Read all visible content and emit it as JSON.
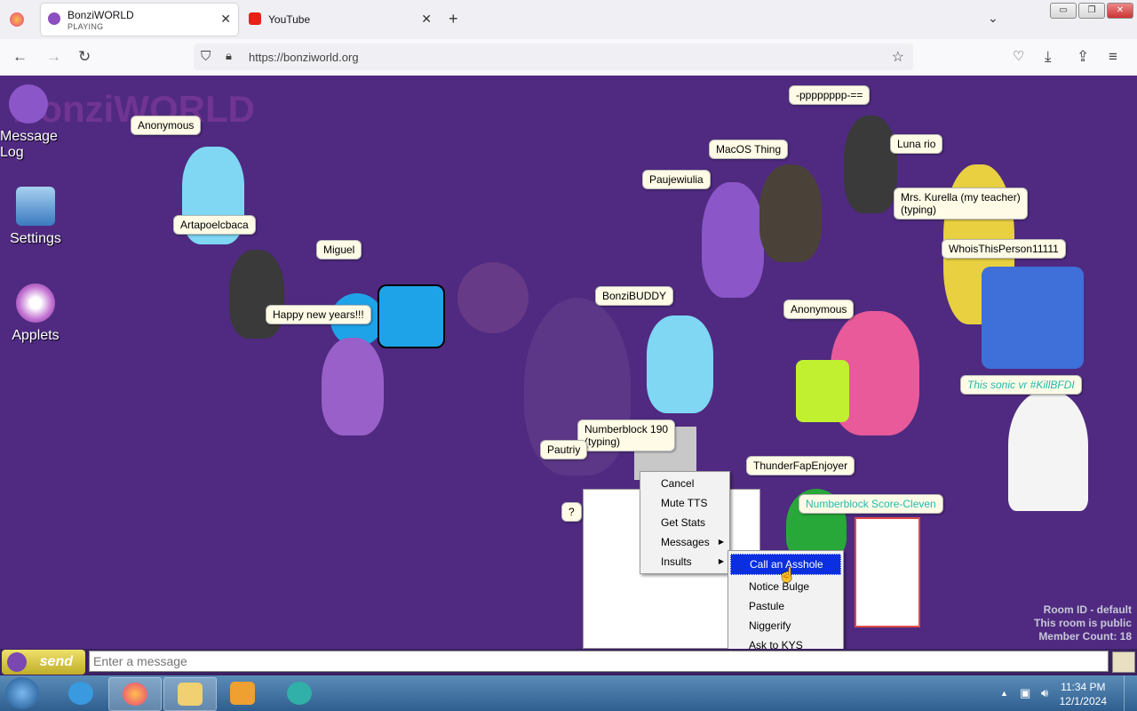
{
  "browser": {
    "tabs": [
      {
        "title": "BonziWORLD",
        "subtitle": "PLAYING"
      },
      {
        "title": "YouTube"
      }
    ],
    "new_tab": "+",
    "url": "https://bonziworld.org",
    "window_buttons": [
      "▭",
      "❐",
      "✕"
    ]
  },
  "desktop_icons": [
    {
      "label": "Message Log"
    },
    {
      "label": "Settings"
    },
    {
      "label": "Applets"
    }
  ],
  "watermark": "BonziWORLD",
  "users": [
    {
      "name": "Anonymous"
    },
    {
      "name": "Artapoelcbaca"
    },
    {
      "name": "Miguel"
    },
    {
      "name": "Happy new years!!!"
    },
    {
      "name": "BonziBUDDY"
    },
    {
      "name": "-pppppppp-=="
    },
    {
      "name": "Luna rio"
    },
    {
      "name": "MacOS Thing"
    },
    {
      "name": "Paujewiulia"
    },
    {
      "name": "Mrs. Kurella (my teacher)",
      "status": "(typing)"
    },
    {
      "name": "WhoisThisPerson11111"
    },
    {
      "name": "Anonymous"
    },
    {
      "name": "This sonic vr #KillBFDI"
    },
    {
      "name": "Numberblock 190",
      "status": "(typing)"
    },
    {
      "name": "Pautriy"
    },
    {
      "name": "ThunderFapEnjoyer"
    },
    {
      "name": "Numberblock Score-Cleven"
    },
    {
      "name": "?"
    }
  ],
  "context_menu": {
    "items": [
      {
        "label": "Cancel"
      },
      {
        "label": "Mute TTS"
      },
      {
        "label": "Get Stats"
      },
      {
        "label": "Messages",
        "submenu": true
      },
      {
        "label": "Insults",
        "submenu": true
      }
    ],
    "submenu": [
      {
        "label": "Call an Asshole",
        "highlighted": true
      },
      {
        "label": "Notice Bulge"
      },
      {
        "label": "Pastule"
      },
      {
        "label": "Niggerify"
      },
      {
        "label": "Ask to KYS"
      }
    ]
  },
  "room_info": {
    "room_id": "Room ID - default",
    "visibility": "This room is public",
    "member_count": "Member Count: 18"
  },
  "chat": {
    "send_label": "send",
    "placeholder": "Enter a message"
  },
  "taskbar": {
    "time": "11:34 PM",
    "date": "12/1/2024",
    "apps": [
      "internet-explorer",
      "firefox",
      "file-explorer",
      "media-player",
      "app"
    ]
  },
  "colors": {
    "page_background": "#4f2a80",
    "selection": "#0a2ee0",
    "bubble": "#fffbe6",
    "teal_text": "#22b8b0"
  }
}
